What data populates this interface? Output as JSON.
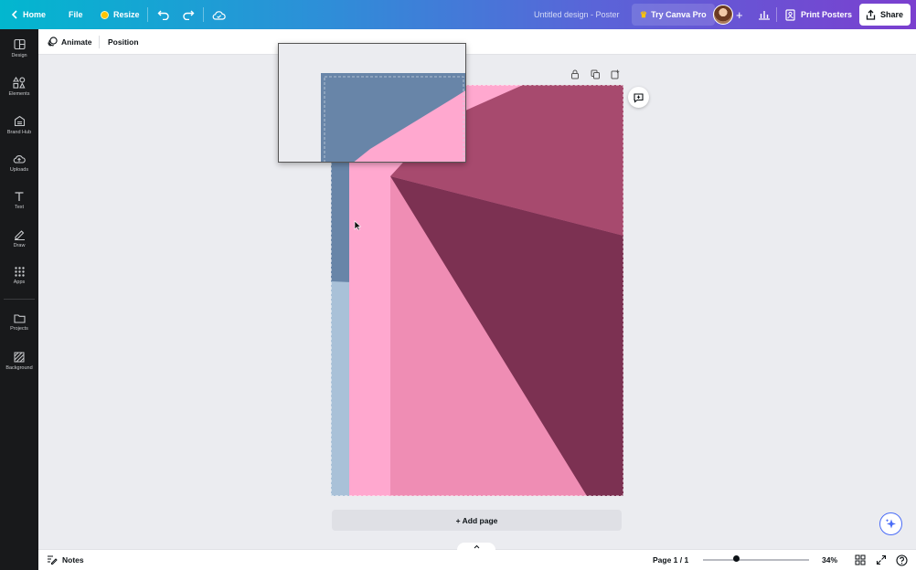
{
  "topbar": {
    "home_label": "Home",
    "file_label": "File",
    "resize_label": "Resize",
    "document_title": "Untitled design - Poster",
    "try_pro_label": "Try Canva Pro",
    "print_label": "Print Posters",
    "share_label": "Share"
  },
  "sidebar": {
    "items": [
      {
        "label": "Design",
        "icon": "design-icon"
      },
      {
        "label": "Elements",
        "icon": "elements-icon"
      },
      {
        "label": "Brand Hub",
        "icon": "brand-hub-icon"
      },
      {
        "label": "Uploads",
        "icon": "uploads-icon"
      },
      {
        "label": "Text",
        "icon": "text-icon"
      },
      {
        "label": "Draw",
        "icon": "draw-icon"
      },
      {
        "label": "Apps",
        "icon": "apps-icon"
      },
      {
        "label": "Projects",
        "icon": "folder-icon"
      },
      {
        "label": "Background",
        "icon": "background-icon"
      }
    ]
  },
  "toolbar": {
    "animate_label": "Animate",
    "position_label": "Position"
  },
  "canvas": {
    "add_page_label": "+ Add page",
    "colors": {
      "pink_light": "#ffa8cf",
      "pink_mid": "#ef8db4",
      "wine": "#a74a6e",
      "wine_dark": "#7c3152",
      "slate_blue": "#6885a8",
      "pale_blue": "#a9c1d8"
    }
  },
  "bottombar": {
    "notes_label": "Notes",
    "page_indicator": "Page 1 / 1",
    "zoom_level": "34%"
  }
}
